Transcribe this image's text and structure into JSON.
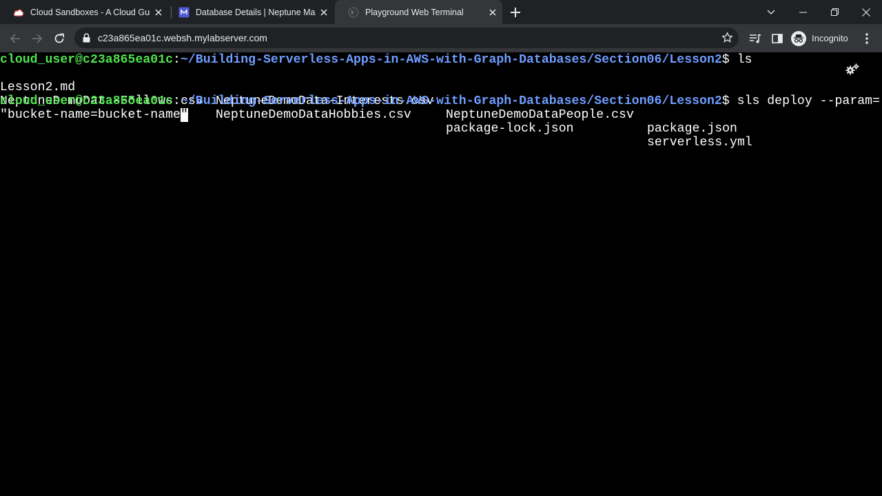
{
  "browser": {
    "tabs": [
      {
        "title": "Cloud Sandboxes - A Cloud Guru",
        "icon": "cloud-icon",
        "active": false
      },
      {
        "title": "Database Details | Neptune Management",
        "icon": "neptune-icon",
        "active": false
      },
      {
        "title": "Playground Web Terminal",
        "icon": "terminal-globe-icon",
        "active": true
      }
    ],
    "url": "c23a865ea01c.websh.mylabserver.com",
    "profile_label": "Incognito"
  },
  "terminal": {
    "line1": {
      "user": "cloud_user@c23a865ea01c",
      "sep": ":",
      "path": "~/Building-Serverless-Apps-in-AWS-with-Graph-Databases/Section06/Lesson2",
      "suffix": "$ ls"
    },
    "ls_output": [
      [
        "Lesson2.md",
        "NeptuneDemoData-Interests.csv",
        "NeptuneDemoDataPeople.csv",
        "package.json"
      ],
      [
        "NeptuneDemoData-Follows.csv",
        "NeptuneDemoDataHobbies.csv",
        "package-lock.json",
        "serverless.yml"
      ]
    ],
    "line4": {
      "user": "cloud_user@c23a865ea01c",
      "sep": ":",
      "path": "~/Building-Serverless-Apps-in-AWS-with-Graph-Databases/Section06/Lesson2",
      "suffix": "$ sls deploy --param="
    },
    "line5": {
      "text": "\"bucket-name=bucket-name",
      "cursor_char": "\""
    }
  },
  "colors": {
    "prompt_user": "#4fe34f",
    "prompt_path": "#6f9dff",
    "terminal_bg": "#000000",
    "chrome_dark": "#202124",
    "chrome_toolbar": "#35363a"
  }
}
